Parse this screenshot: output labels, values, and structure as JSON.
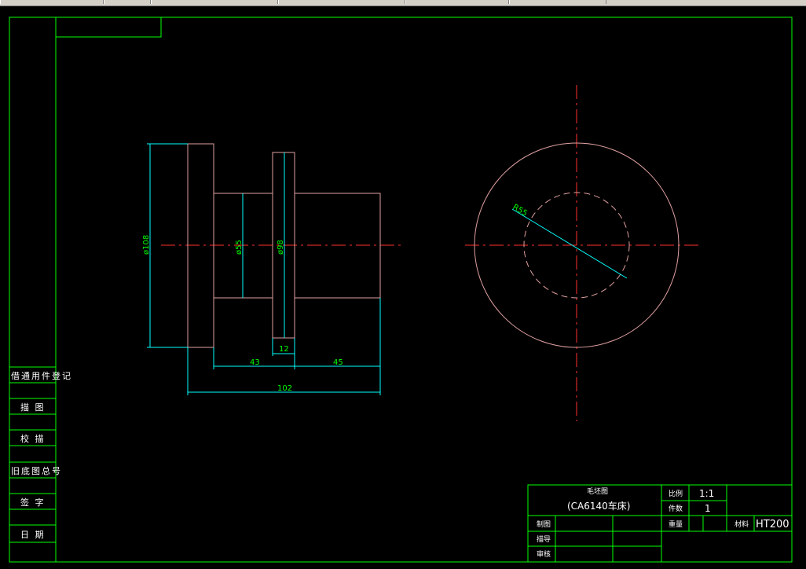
{
  "drawing": {
    "dims": {
      "d108": "ø108",
      "d55": "ø55",
      "d98": "ø98",
      "w12": "12",
      "w43": "43",
      "w45": "45",
      "w102": "102",
      "r": "R55"
    },
    "side_labels": [
      "借通用件登记",
      "描 图",
      "校 描",
      "旧底图总号",
      "签 字",
      "日 期"
    ],
    "title_block": {
      "name": "毛坯图",
      "subtitle": "(CA6140车床)",
      "scale_label": "比例",
      "scale_value": "1:1",
      "qty_label": "件数",
      "qty_value": "1",
      "weight_label": "重量",
      "material_label": "材料",
      "material_value": "HT200",
      "draw_label": "制图",
      "design_label": "描导",
      "review_label": "审核"
    }
  }
}
